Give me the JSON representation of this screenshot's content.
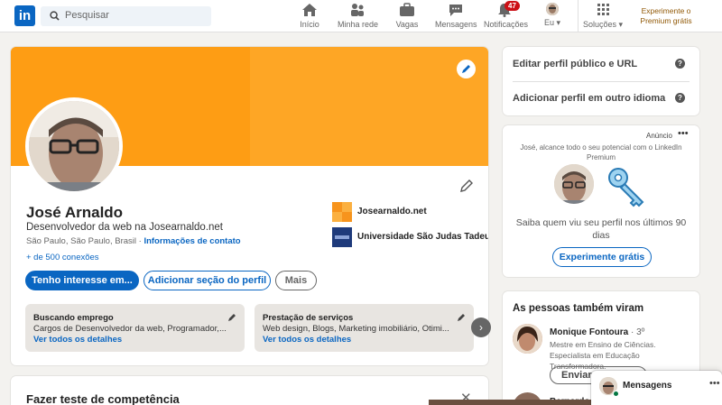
{
  "nav": {
    "logo": "in",
    "search_placeholder": "Pesquisar",
    "items": [
      {
        "label": "Início",
        "icon": "home-icon"
      },
      {
        "label": "Minha rede",
        "icon": "network-icon"
      },
      {
        "label": "Vagas",
        "icon": "briefcase-icon"
      },
      {
        "label": "Mensagens",
        "icon": "chat-icon"
      },
      {
        "label": "Notificações",
        "icon": "bell-icon",
        "badge": "47"
      },
      {
        "label": "Eu",
        "icon": "avatar-icon"
      },
      {
        "label": "Soluções",
        "icon": "grid-icon"
      }
    ],
    "premium_line1": "Experimente o",
    "premium_line2": "Premium grátis"
  },
  "profile": {
    "name": "José Arnaldo",
    "headline": "Desenvolvedor da web na Josearnaldo.net",
    "location": "São Paulo, São Paulo, Brasil ·",
    "contact_link": "Informações de contato",
    "connections": "+ de 500 conexões",
    "orgs": [
      {
        "name": "Josearnaldo.net"
      },
      {
        "name": "Universidade São Judas Tadeu"
      }
    ],
    "buttons": {
      "interest": "Tenho interesse em...",
      "add_section": "Adicionar seção do perfil",
      "more": "Mais"
    },
    "boxes": [
      {
        "title": "Buscando emprego",
        "text": "Cargos de Desenvolvedor da web, Programador,...",
        "link": "Ver todos os detalhes"
      },
      {
        "title": "Prestação de serviços",
        "text": "Web design, Blogs, Marketing imobiliário, Otimi...",
        "link": "Ver todos os detalhes"
      }
    ]
  },
  "skill": {
    "title": "Fazer teste de competência"
  },
  "side": {
    "edit_public": "Editar perfil público e URL",
    "add_language": "Adicionar perfil em outro idioma"
  },
  "ad": {
    "label": "Anúncio",
    "text": "José, alcance todo o seu potencial com o LinkedIn Premium",
    "message": "Saiba quem viu seu perfil nos últimos 90 dias",
    "button": "Experimente grátis"
  },
  "people": {
    "title": "As pessoas também viram",
    "items": [
      {
        "name": "Monique Fontoura",
        "degree": "· 3º",
        "desc": "Mestre em Ensino de Ciências. Especialista em Educação Transformadora.",
        "button": "Enviar m"
      },
      {
        "name": "Bernardo C"
      }
    ]
  },
  "messaging": {
    "label": "Mensagens"
  },
  "colors": {
    "brand": "#0a66c2",
    "cover": "#fea625",
    "premium": "#915907",
    "badge": "#cc1016"
  }
}
